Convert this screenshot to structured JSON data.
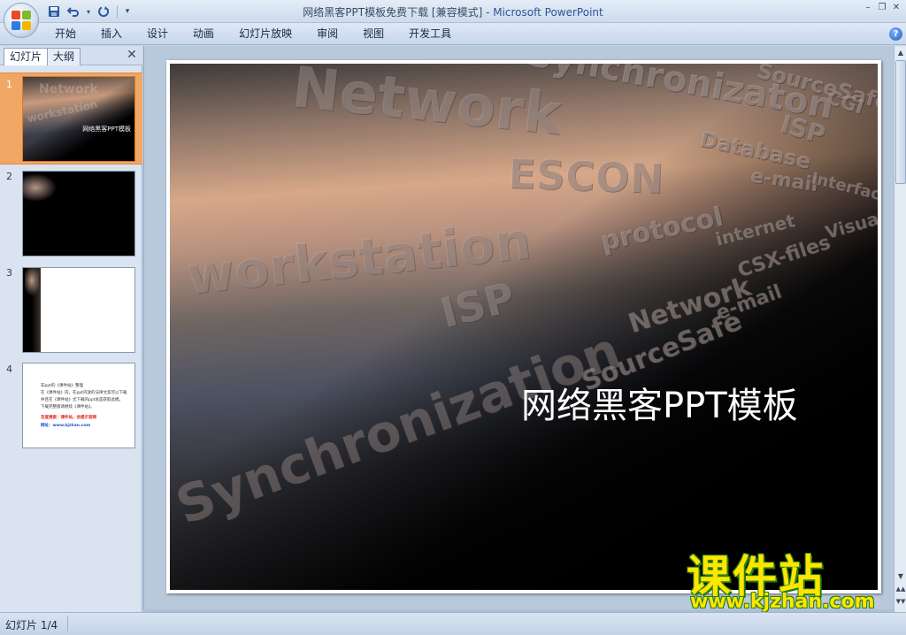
{
  "window": {
    "title": "网络黑客PPT模板免费下载 [兼容模式]",
    "title_separator": " - ",
    "app_name": "Microsoft PowerPoint"
  },
  "quick_access": [
    {
      "name": "save-icon",
      "glyph": "💾"
    },
    {
      "name": "undo-icon",
      "glyph": "↶"
    },
    {
      "name": "redo-icon",
      "glyph": "↻"
    }
  ],
  "menu": {
    "tabs": [
      "开始",
      "插入",
      "设计",
      "动画",
      "幻灯片放映",
      "审阅",
      "视图",
      "开发工具"
    ]
  },
  "panel": {
    "tab_slides": "幻灯片",
    "tab_outline": "大纲",
    "thumbnails": [
      {
        "number": "1",
        "title": "网络黑客PPT模板"
      },
      {
        "number": "2"
      },
      {
        "number": "3"
      },
      {
        "number": "4",
        "lines": [
          "  非ppt的《课件站》整理",
          "在《课件站》内，在ppt内放的法律文案可以下载",
          "并且在《课件站》尤下载的ppt总是获取此模。",
          "下载完整版请继续《课件站》。",
          "百度搜索：课件站，会提示官网",
          "网址：www.kjzhan.com"
        ]
      }
    ]
  },
  "slide": {
    "title": "网络黑客PPT模板",
    "background_words": [
      "Network",
      "Synchronizaton",
      "SourceSafe",
      "CGI",
      "ISP",
      "ESCON",
      "Database",
      "e-mail",
      "Interface",
      "workstation",
      "protocol",
      "internet",
      "CSX-files",
      "ISP",
      "Network",
      "e-mail",
      "SourceSafe",
      "Synchronization",
      "Visual"
    ]
  },
  "watermark": {
    "cn": "课件站",
    "url": "www.kjzhan.com"
  },
  "status": {
    "slide_count": "幻灯片 1/4"
  },
  "colors": {
    "accent": "#f1a764",
    "title_bar": "#dfe8f5",
    "status_bar": "#c3d3e8",
    "watermark": "#ffe600"
  }
}
